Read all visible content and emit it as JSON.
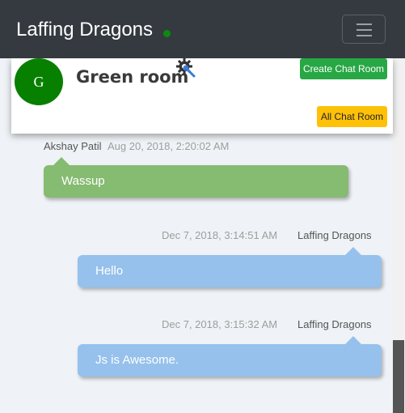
{
  "navbar": {
    "brand": "Laffing Dragons",
    "status_color": "#0c8a0c",
    "menu_icon": "hamburger-menu-icon"
  },
  "room": {
    "avatar_letter": "G",
    "avatar_color": "#078000",
    "name": "Green room",
    "settings_icon": "gear-wrench-icon",
    "create_button": "Create Chat Room",
    "all_button": "All Chat Room"
  },
  "messages": [
    {
      "author": "Akshay Patil",
      "time": "Aug 20, 2018, 2:20:02 AM",
      "text": "Wassup",
      "side": "left",
      "color": "#86bb72"
    },
    {
      "author": "Laffing Dragons",
      "time": "Dec 7, 2018, 3:14:51 AM",
      "text": "Hello",
      "side": "right",
      "color": "#96c1ec"
    },
    {
      "author": "Laffing Dragons",
      "time": "Dec 7, 2018, 3:15:32 AM",
      "text": "Js is Awesome.",
      "side": "right",
      "color": "#96c1ec"
    }
  ]
}
